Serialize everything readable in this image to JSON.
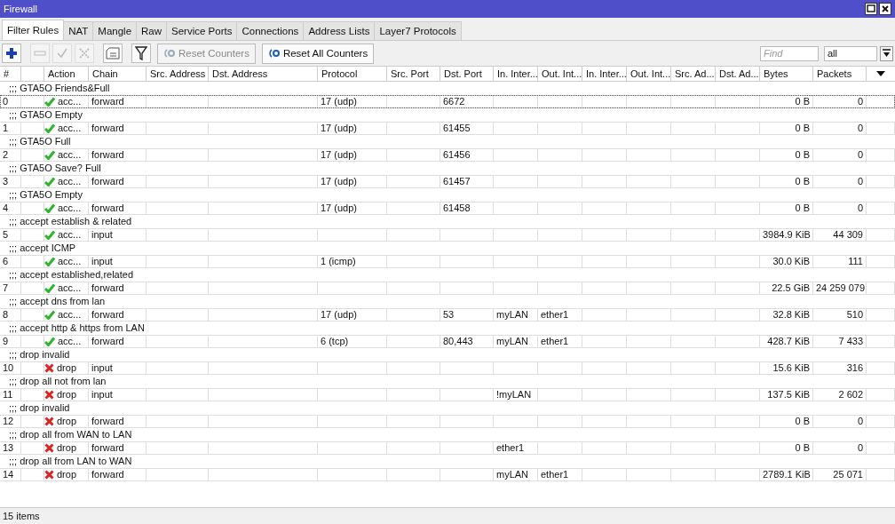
{
  "window": {
    "title": "Firewall"
  },
  "tabs": [
    {
      "label": "Filter Rules",
      "selected": true
    },
    {
      "label": "NAT",
      "selected": false
    },
    {
      "label": "Mangle",
      "selected": false
    },
    {
      "label": "Raw",
      "selected": false
    },
    {
      "label": "Service Ports",
      "selected": false
    },
    {
      "label": "Connections",
      "selected": false
    },
    {
      "label": "Address Lists",
      "selected": false
    },
    {
      "label": "Layer7 Protocols",
      "selected": false
    }
  ],
  "toolbar": {
    "icons": [
      {
        "kind": "add",
        "disabled": false
      },
      {
        "kind": "remove",
        "disabled": true
      },
      {
        "kind": "enable",
        "disabled": true
      },
      {
        "kind": "disable",
        "disabled": true
      },
      {
        "kind": "comment",
        "disabled": false
      },
      {
        "kind": "filter",
        "disabled": false
      }
    ],
    "buttons": [
      {
        "label": "Reset Counters",
        "disabled": true
      },
      {
        "label": "Reset All Counters",
        "disabled": false
      }
    ],
    "find": {
      "placeholder": "Find"
    },
    "scope": {
      "value": "all"
    }
  },
  "table": {
    "columns": [
      "#",
      "Action",
      "Chain",
      "Src. Address",
      "Dst. Address",
      "Protocol",
      "Src. Port",
      "Dst. Port",
      "In. Inter...",
      "Out. Int...",
      "In. Inter...",
      "Out. Int...",
      "Src. Ad...",
      "Dst. Ad...",
      "Bytes",
      "Packets"
    ],
    "rows": [
      {
        "comment": ";;; GTA5O Friends&Full",
        "number": "0",
        "kind": "accept",
        "action": "acc...",
        "chain": "forward",
        "protocol": "17 (udp)",
        "dst_port": "6672",
        "bytes": "0 B",
        "packets": "0",
        "focused": true
      },
      {
        "comment": ";;; GTA5O Empty",
        "number": "1",
        "kind": "accept",
        "action": "acc...",
        "chain": "forward",
        "protocol": "17 (udp)",
        "dst_port": "61455",
        "bytes": "0 B",
        "packets": "0",
        "focused": false
      },
      {
        "comment": ";;; GTA5O Full",
        "number": "2",
        "kind": "accept",
        "action": "acc...",
        "chain": "forward",
        "protocol": "17 (udp)",
        "dst_port": "61456",
        "bytes": "0 B",
        "packets": "0",
        "focused": false
      },
      {
        "comment": ";;; GTA5O Save? Full",
        "number": "3",
        "kind": "accept",
        "action": "acc...",
        "chain": "forward",
        "protocol": "17 (udp)",
        "dst_port": "61457",
        "bytes": "0 B",
        "packets": "0",
        "focused": false
      },
      {
        "comment": ";;; GTA5O Empty",
        "number": "4",
        "kind": "accept",
        "action": "acc...",
        "chain": "forward",
        "protocol": "17 (udp)",
        "dst_port": "61458",
        "bytes": "0 B",
        "packets": "0",
        "focused": false
      },
      {
        "comment": ";;; accept establish & related",
        "number": "5",
        "kind": "accept",
        "action": "acc...",
        "chain": "input",
        "bytes": "3984.9 KiB",
        "packets": "44 309",
        "focused": false
      },
      {
        "comment": ";;; accept ICMP",
        "number": "6",
        "kind": "accept",
        "action": "acc...",
        "chain": "input",
        "protocol": "1 (icmp)",
        "bytes": "30.0 KiB",
        "packets": "111",
        "focused": false
      },
      {
        "comment": ";;; accept established,related",
        "number": "7",
        "kind": "accept",
        "action": "acc...",
        "chain": "forward",
        "bytes": "22.5 GiB",
        "packets": "24 259 079",
        "focused": false
      },
      {
        "comment": ";;; accept dns from lan",
        "number": "8",
        "kind": "accept",
        "action": "acc...",
        "chain": "forward",
        "protocol": "17 (udp)",
        "dst_port": "53",
        "in_interface": "myLAN",
        "out_interface": "ether1",
        "bytes": "32.8 KiB",
        "packets": "510",
        "focused": false
      },
      {
        "comment": ";;; accept http & https from LAN",
        "number": "9",
        "kind": "accept",
        "action": "acc...",
        "chain": "forward",
        "protocol": "6 (tcp)",
        "dst_port": "80,443",
        "in_interface": "myLAN",
        "out_interface": "ether1",
        "bytes": "428.7 KiB",
        "packets": "7 433",
        "focused": false
      },
      {
        "comment": ";;; drop invalid",
        "number": "10",
        "kind": "drop",
        "action": "drop",
        "chain": "input",
        "bytes": "15.6 KiB",
        "packets": "316",
        "focused": false
      },
      {
        "comment": ";;; drop all not from lan",
        "number": "11",
        "kind": "drop",
        "action": "drop",
        "chain": "input",
        "in_interface": "!myLAN",
        "bytes": "137.5 KiB",
        "packets": "2 602",
        "focused": false
      },
      {
        "comment": ";;; drop invalid",
        "number": "12",
        "kind": "drop",
        "action": "drop",
        "chain": "forward",
        "bytes": "0 B",
        "packets": "0",
        "focused": false
      },
      {
        "comment": ";;; drop all from WAN to LAN",
        "number": "13",
        "kind": "drop",
        "action": "drop",
        "chain": "forward",
        "in_interface": "ether1",
        "bytes": "0 B",
        "packets": "0",
        "focused": false
      },
      {
        "comment": ";;; drop all from LAN to WAN",
        "number": "14",
        "kind": "drop",
        "action": "drop",
        "chain": "forward",
        "in_interface": "myLAN",
        "out_interface": "ether1",
        "bytes": "2789.1 KiB",
        "packets": "25 071",
        "focused": false
      }
    ]
  },
  "status_bar": "15 items"
}
